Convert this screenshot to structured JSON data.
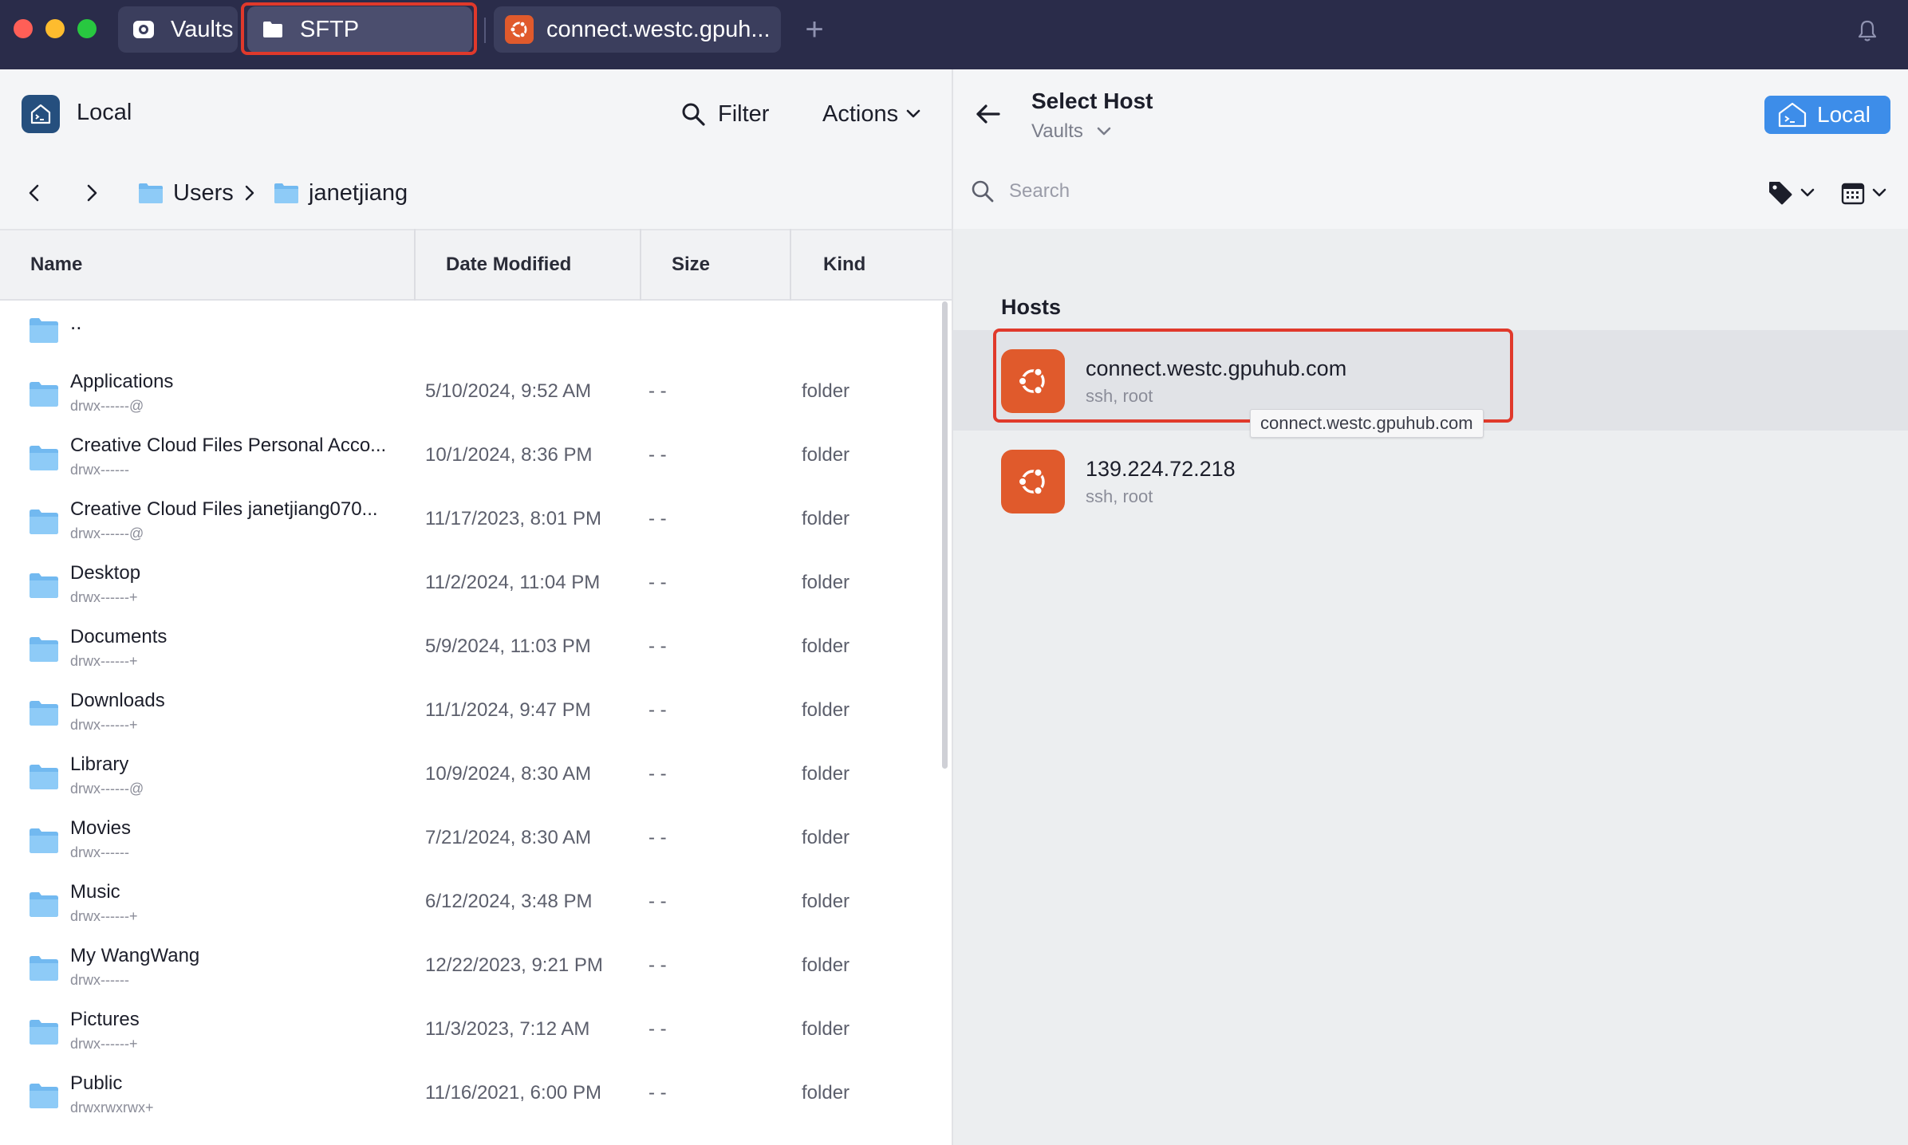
{
  "titlebar": {
    "tabs": [
      {
        "label": "Vaults",
        "icon": "vault-icon"
      },
      {
        "label": "SFTP",
        "icon": "folder-icon"
      },
      {
        "label": "connect.westc.gpuh...",
        "icon": "ubuntu-icon"
      }
    ],
    "add_tab": "+"
  },
  "left": {
    "title": "Local",
    "filter_label": "Filter",
    "actions_label": "Actions",
    "breadcrumb": [
      "Users",
      "janetjiang"
    ],
    "columns": [
      "Name",
      "Date Modified",
      "Size",
      "Kind"
    ],
    "parent_label": "..",
    "rows": [
      {
        "name": "Applications",
        "perm": "drwx------@",
        "date": "5/10/2024, 9:52 AM",
        "size": "- -",
        "kind": "folder"
      },
      {
        "name": "Creative Cloud Files Personal Acco...",
        "perm": "drwx------",
        "date": "10/1/2024, 8:36 PM",
        "size": "- -",
        "kind": "folder"
      },
      {
        "name": "Creative Cloud Files janetjiang070...",
        "perm": "drwx------@",
        "date": "11/17/2023, 8:01 PM",
        "size": "- -",
        "kind": "folder"
      },
      {
        "name": "Desktop",
        "perm": "drwx------+",
        "date": "11/2/2024, 11:04 PM",
        "size": "- -",
        "kind": "folder"
      },
      {
        "name": "Documents",
        "perm": "drwx------+",
        "date": "5/9/2024, 11:03 PM",
        "size": "- -",
        "kind": "folder"
      },
      {
        "name": "Downloads",
        "perm": "drwx------+",
        "date": "11/1/2024, 9:47 PM",
        "size": "- -",
        "kind": "folder"
      },
      {
        "name": "Library",
        "perm": "drwx------@",
        "date": "10/9/2024, 8:30 AM",
        "size": "- -",
        "kind": "folder"
      },
      {
        "name": "Movies",
        "perm": "drwx------",
        "date": "7/21/2024, 8:30 AM",
        "size": "- -",
        "kind": "folder"
      },
      {
        "name": "Music",
        "perm": "drwx------+",
        "date": "6/12/2024, 3:48 PM",
        "size": "- -",
        "kind": "folder"
      },
      {
        "name": "My WangWang",
        "perm": "drwx------",
        "date": "12/22/2023, 9:21 PM",
        "size": "- -",
        "kind": "folder"
      },
      {
        "name": "Pictures",
        "perm": "drwx------+",
        "date": "11/3/2023, 7:12 AM",
        "size": "- -",
        "kind": "folder"
      },
      {
        "name": "Public",
        "perm": "drwxrwxrwx+",
        "date": "11/16/2021, 6:00 PM",
        "size": "- -",
        "kind": "folder"
      }
    ]
  },
  "right": {
    "title": "Select Host",
    "vault_selector": "Vaults",
    "local_button": "Local",
    "search_placeholder": "Search",
    "hosts_heading": "Hosts",
    "hosts": [
      {
        "name": "connect.westc.gpuhub.com",
        "sub": "ssh, root"
      },
      {
        "name": "139.224.72.218",
        "sub": "ssh, root"
      }
    ],
    "tooltip": "connect.westc.gpuhub.com"
  },
  "colors": {
    "titlebar": "#2a2c4a",
    "accent_blue": "#3d8de9",
    "ubuntu_orange": "#e05a2c",
    "highlight_red": "#e0392b",
    "folder_blue": "#72b9f0"
  }
}
